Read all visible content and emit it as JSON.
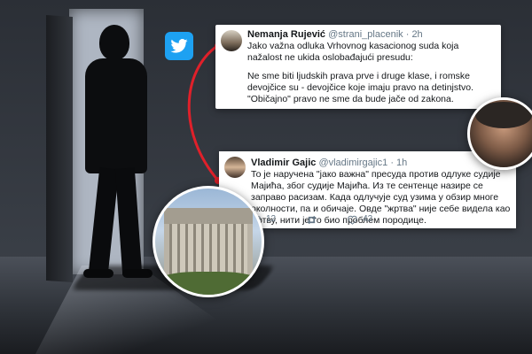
{
  "tweets": [
    {
      "name": "Nemanja Rujević",
      "handle": "@strani_placenik",
      "time": "· 2h",
      "paragraphs": [
        "Jako važna odluka Vrhovnog kasacionog suda koja nažalost ne ukida oslobađajući presudu:",
        "Ne sme biti ljudskih prava prve i druge klase, i romske devojčice su - devojčice koje imaju pravo na detinjstvo. \"Običajno\" pravo ne sme da bude jače od zakona."
      ]
    },
    {
      "name": "Vladimir Gajic",
      "handle": "@vladimirgajic1",
      "time": "· 1h",
      "text": "То је наручена \"јако важна\" пресуда против одлуке судије Мајића, због судије Мајића. Из те сентенце назире се заправо расизам. Када одлучује суд узима у обзир многе околности, па и обичаје. Овде \"жртва\" није себе видела као жртву, нити је то био проблем породице.",
      "actions": {
        "replies": "12",
        "likes": "42"
      }
    }
  ],
  "colors": {
    "twitter_blue": "#1da1f2",
    "connector_red": "#e0202a"
  },
  "icons": [
    "twitter-bird-icon",
    "reply-icon",
    "retweet-icon",
    "like-icon"
  ]
}
